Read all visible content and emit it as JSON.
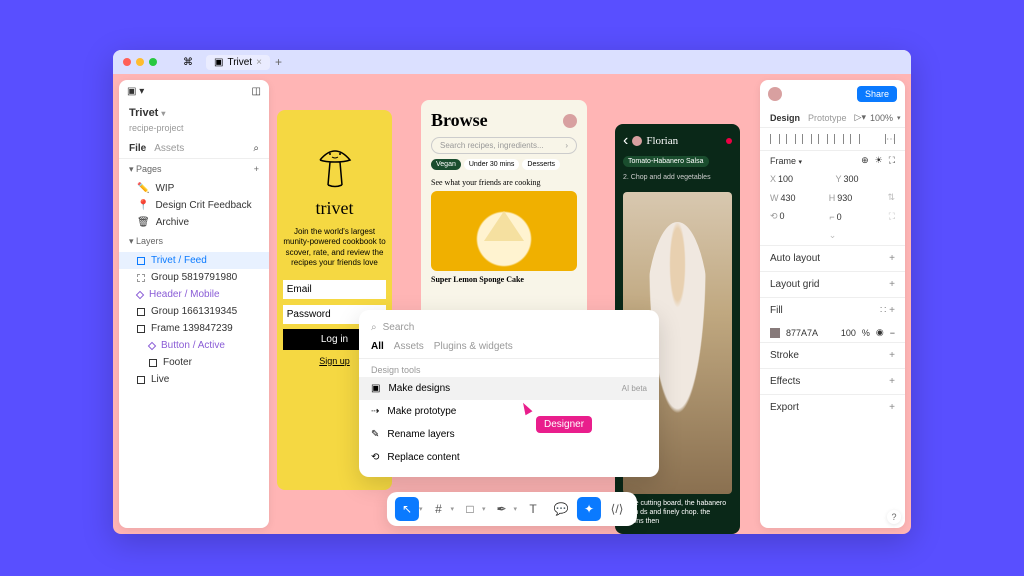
{
  "titlebar": {
    "tab_name": "Trivet"
  },
  "left_panel": {
    "project_name": "Trivet",
    "project_subtitle": "recipe-project",
    "tabs": {
      "file": "File",
      "assets": "Assets"
    },
    "pages": {
      "label": "Pages",
      "items": [
        "WIP",
        "Design Crit Feedback",
        "Archive"
      ]
    },
    "layers": {
      "label": "Layers",
      "items": [
        {
          "label": "Trivet / Feed",
          "selected": true
        },
        {
          "label": "Group 5819791980"
        },
        {
          "label": "Header / Mobile",
          "purple": true
        },
        {
          "label": "Group 1661319345"
        },
        {
          "label": "Frame 139847239"
        },
        {
          "label": "Button / Active",
          "purple": true,
          "indent": true
        },
        {
          "label": "Footer",
          "indent": true
        },
        {
          "label": "Live"
        }
      ]
    }
  },
  "artboard1": {
    "logo_text": "trivet",
    "description": "Join the world's largest munity-powered cookbook to scover, rate, and review the recipes your friends love",
    "email": "Email",
    "password": "Password",
    "login": "Log in",
    "signup": "Sign up"
  },
  "artboard2": {
    "title": "Browse",
    "search_placeholder": "Search recipes, ingredients...",
    "pills": [
      "Vegan",
      "Under 30 mins",
      "Desserts"
    ],
    "friends": "See what your friends are cooking",
    "caption": "Super Lemon Sponge Cake"
  },
  "artboard3": {
    "user": "Florian",
    "tag": "Tomato-Habanero Salsa",
    "step": "2. Chop and add vegetables",
    "recipe": "large cutting board, the habanero stem ds and finely chop. the onions then"
  },
  "search_popup": {
    "placeholder": "Search",
    "tabs": [
      "All",
      "Assets",
      "Plugins & widgets"
    ],
    "section": "Design tools",
    "items": [
      {
        "label": "Make designs",
        "badge": "AI beta",
        "hover": true
      },
      {
        "label": "Make prototype"
      },
      {
        "label": "Rename layers"
      },
      {
        "label": "Replace content"
      }
    ]
  },
  "cursor": {
    "label": "Designer"
  },
  "right_panel": {
    "share": "Share",
    "tabs": {
      "design": "Design",
      "prototype": "Prototype"
    },
    "zoom": "100%",
    "frame_label": "Frame",
    "pos": {
      "x_label": "X",
      "x": "100",
      "y_label": "Y",
      "y": "300"
    },
    "size": {
      "w_label": "W",
      "w": "430",
      "h_label": "H",
      "h": "930"
    },
    "rotation": {
      "angle_label": "",
      "angle": "0",
      "corner_label": "",
      "corner": "0"
    },
    "sections": {
      "autolayout": "Auto layout",
      "layoutgrid": "Layout grid",
      "fill": "Fill",
      "stroke": "Stroke",
      "effects": "Effects",
      "export": "Export"
    },
    "fill": {
      "hex": "877A7A",
      "opacity": "100",
      "unit": "%"
    }
  },
  "help": "?"
}
